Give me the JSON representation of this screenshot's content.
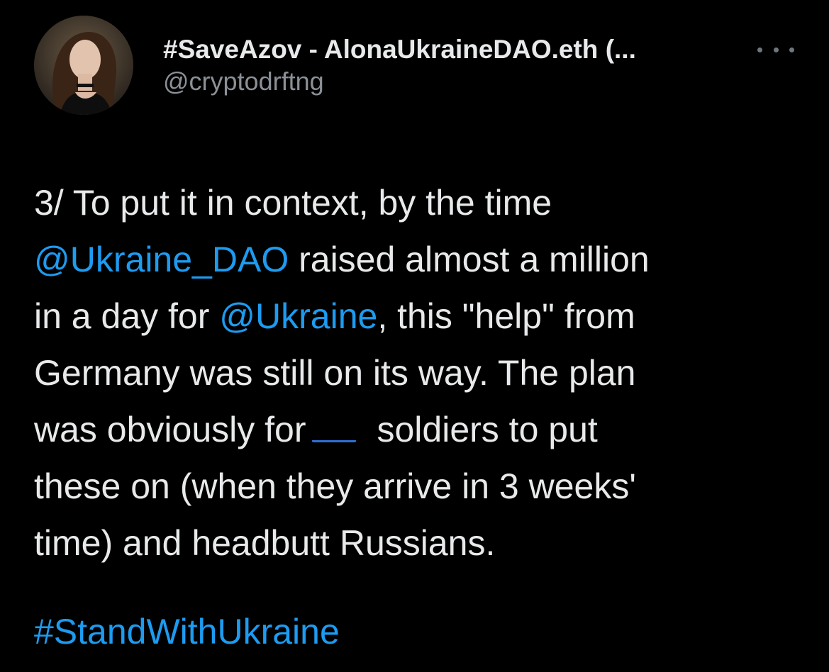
{
  "author": {
    "display_name": "#SaveAzov - AlonaUkraineDAO.eth (...",
    "handle": "@cryptodrftng",
    "avatar_icon": "profile-photo"
  },
  "more_icon": "more-horizontal-icon",
  "body": {
    "line1": "3/ To put it in context, by the time",
    "mention_ukraine_dao": "@Ukraine_DAO",
    "line2_rest": " raised almost a million",
    "line3_start": "in a day for ",
    "mention_ukraine": "@Ukraine",
    "line3_rest": ", this \"help\" from",
    "line4": "Germany was still on its way. The plan",
    "line5_start": "was obviously for",
    "flag_icon": "ukraine-flag-icon",
    "line5_rest": "soldiers to put",
    "line6": "these on (when they arrive in 3 weeks'",
    "line7": "time) and headbutt Russians."
  },
  "hashtag": "#StandWithUkraine",
  "colors": {
    "background": "#000000",
    "text": "#e7e9ea",
    "secondary_text": "#8b9096",
    "link": "#1d9bf0",
    "flag_blue": "#2f6fd6",
    "flag_yellow": "#f5cf2e"
  }
}
